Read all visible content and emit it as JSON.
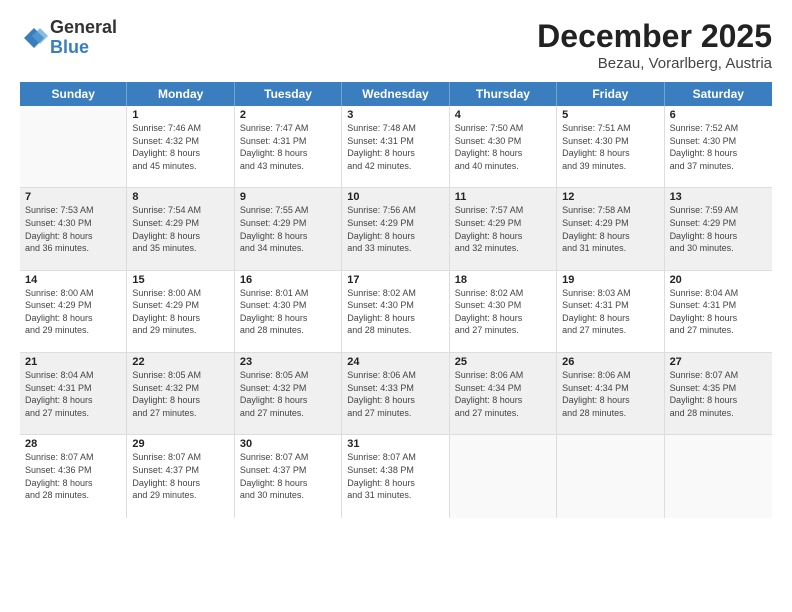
{
  "logo": {
    "general": "General",
    "blue": "Blue"
  },
  "title": {
    "month": "December 2025",
    "location": "Bezau, Vorarlberg, Austria"
  },
  "days_of_week": [
    "Sunday",
    "Monday",
    "Tuesday",
    "Wednesday",
    "Thursday",
    "Friday",
    "Saturday"
  ],
  "weeks": [
    [
      {
        "num": "",
        "empty": true
      },
      {
        "num": "1",
        "sunrise": "7:46 AM",
        "sunset": "4:32 PM",
        "daylight": "8 hours and 45 minutes."
      },
      {
        "num": "2",
        "sunrise": "7:47 AM",
        "sunset": "4:31 PM",
        "daylight": "8 hours and 43 minutes."
      },
      {
        "num": "3",
        "sunrise": "7:48 AM",
        "sunset": "4:31 PM",
        "daylight": "8 hours and 42 minutes."
      },
      {
        "num": "4",
        "sunrise": "7:50 AM",
        "sunset": "4:30 PM",
        "daylight": "8 hours and 40 minutes."
      },
      {
        "num": "5",
        "sunrise": "7:51 AM",
        "sunset": "4:30 PM",
        "daylight": "8 hours and 39 minutes."
      },
      {
        "num": "6",
        "sunrise": "7:52 AM",
        "sunset": "4:30 PM",
        "daylight": "8 hours and 37 minutes."
      }
    ],
    [
      {
        "num": "7",
        "sunrise": "7:53 AM",
        "sunset": "4:30 PM",
        "daylight": "8 hours and 36 minutes."
      },
      {
        "num": "8",
        "sunrise": "7:54 AM",
        "sunset": "4:29 PM",
        "daylight": "8 hours and 35 minutes."
      },
      {
        "num": "9",
        "sunrise": "7:55 AM",
        "sunset": "4:29 PM",
        "daylight": "8 hours and 34 minutes."
      },
      {
        "num": "10",
        "sunrise": "7:56 AM",
        "sunset": "4:29 PM",
        "daylight": "8 hours and 33 minutes."
      },
      {
        "num": "11",
        "sunrise": "7:57 AM",
        "sunset": "4:29 PM",
        "daylight": "8 hours and 32 minutes."
      },
      {
        "num": "12",
        "sunrise": "7:58 AM",
        "sunset": "4:29 PM",
        "daylight": "8 hours and 31 minutes."
      },
      {
        "num": "13",
        "sunrise": "7:59 AM",
        "sunset": "4:29 PM",
        "daylight": "8 hours and 30 minutes."
      }
    ],
    [
      {
        "num": "14",
        "sunrise": "8:00 AM",
        "sunset": "4:29 PM",
        "daylight": "8 hours and 29 minutes."
      },
      {
        "num": "15",
        "sunrise": "8:00 AM",
        "sunset": "4:29 PM",
        "daylight": "8 hours and 29 minutes."
      },
      {
        "num": "16",
        "sunrise": "8:01 AM",
        "sunset": "4:30 PM",
        "daylight": "8 hours and 28 minutes."
      },
      {
        "num": "17",
        "sunrise": "8:02 AM",
        "sunset": "4:30 PM",
        "daylight": "8 hours and 28 minutes."
      },
      {
        "num": "18",
        "sunrise": "8:02 AM",
        "sunset": "4:30 PM",
        "daylight": "8 hours and 27 minutes."
      },
      {
        "num": "19",
        "sunrise": "8:03 AM",
        "sunset": "4:31 PM",
        "daylight": "8 hours and 27 minutes."
      },
      {
        "num": "20",
        "sunrise": "8:04 AM",
        "sunset": "4:31 PM",
        "daylight": "8 hours and 27 minutes."
      }
    ],
    [
      {
        "num": "21",
        "sunrise": "8:04 AM",
        "sunset": "4:31 PM",
        "daylight": "8 hours and 27 minutes."
      },
      {
        "num": "22",
        "sunrise": "8:05 AM",
        "sunset": "4:32 PM",
        "daylight": "8 hours and 27 minutes."
      },
      {
        "num": "23",
        "sunrise": "8:05 AM",
        "sunset": "4:32 PM",
        "daylight": "8 hours and 27 minutes."
      },
      {
        "num": "24",
        "sunrise": "8:06 AM",
        "sunset": "4:33 PM",
        "daylight": "8 hours and 27 minutes."
      },
      {
        "num": "25",
        "sunrise": "8:06 AM",
        "sunset": "4:34 PM",
        "daylight": "8 hours and 27 minutes."
      },
      {
        "num": "26",
        "sunrise": "8:06 AM",
        "sunset": "4:34 PM",
        "daylight": "8 hours and 28 minutes."
      },
      {
        "num": "27",
        "sunrise": "8:07 AM",
        "sunset": "4:35 PM",
        "daylight": "8 hours and 28 minutes."
      }
    ],
    [
      {
        "num": "28",
        "sunrise": "8:07 AM",
        "sunset": "4:36 PM",
        "daylight": "8 hours and 28 minutes."
      },
      {
        "num": "29",
        "sunrise": "8:07 AM",
        "sunset": "4:37 PM",
        "daylight": "8 hours and 29 minutes."
      },
      {
        "num": "30",
        "sunrise": "8:07 AM",
        "sunset": "4:37 PM",
        "daylight": "8 hours and 30 minutes."
      },
      {
        "num": "31",
        "sunrise": "8:07 AM",
        "sunset": "4:38 PM",
        "daylight": "8 hours and 31 minutes."
      },
      {
        "num": "",
        "empty": true
      },
      {
        "num": "",
        "empty": true
      },
      {
        "num": "",
        "empty": true
      }
    ]
  ],
  "labels": {
    "sunrise": "Sunrise:",
    "sunset": "Sunset:",
    "daylight": "Daylight:"
  }
}
